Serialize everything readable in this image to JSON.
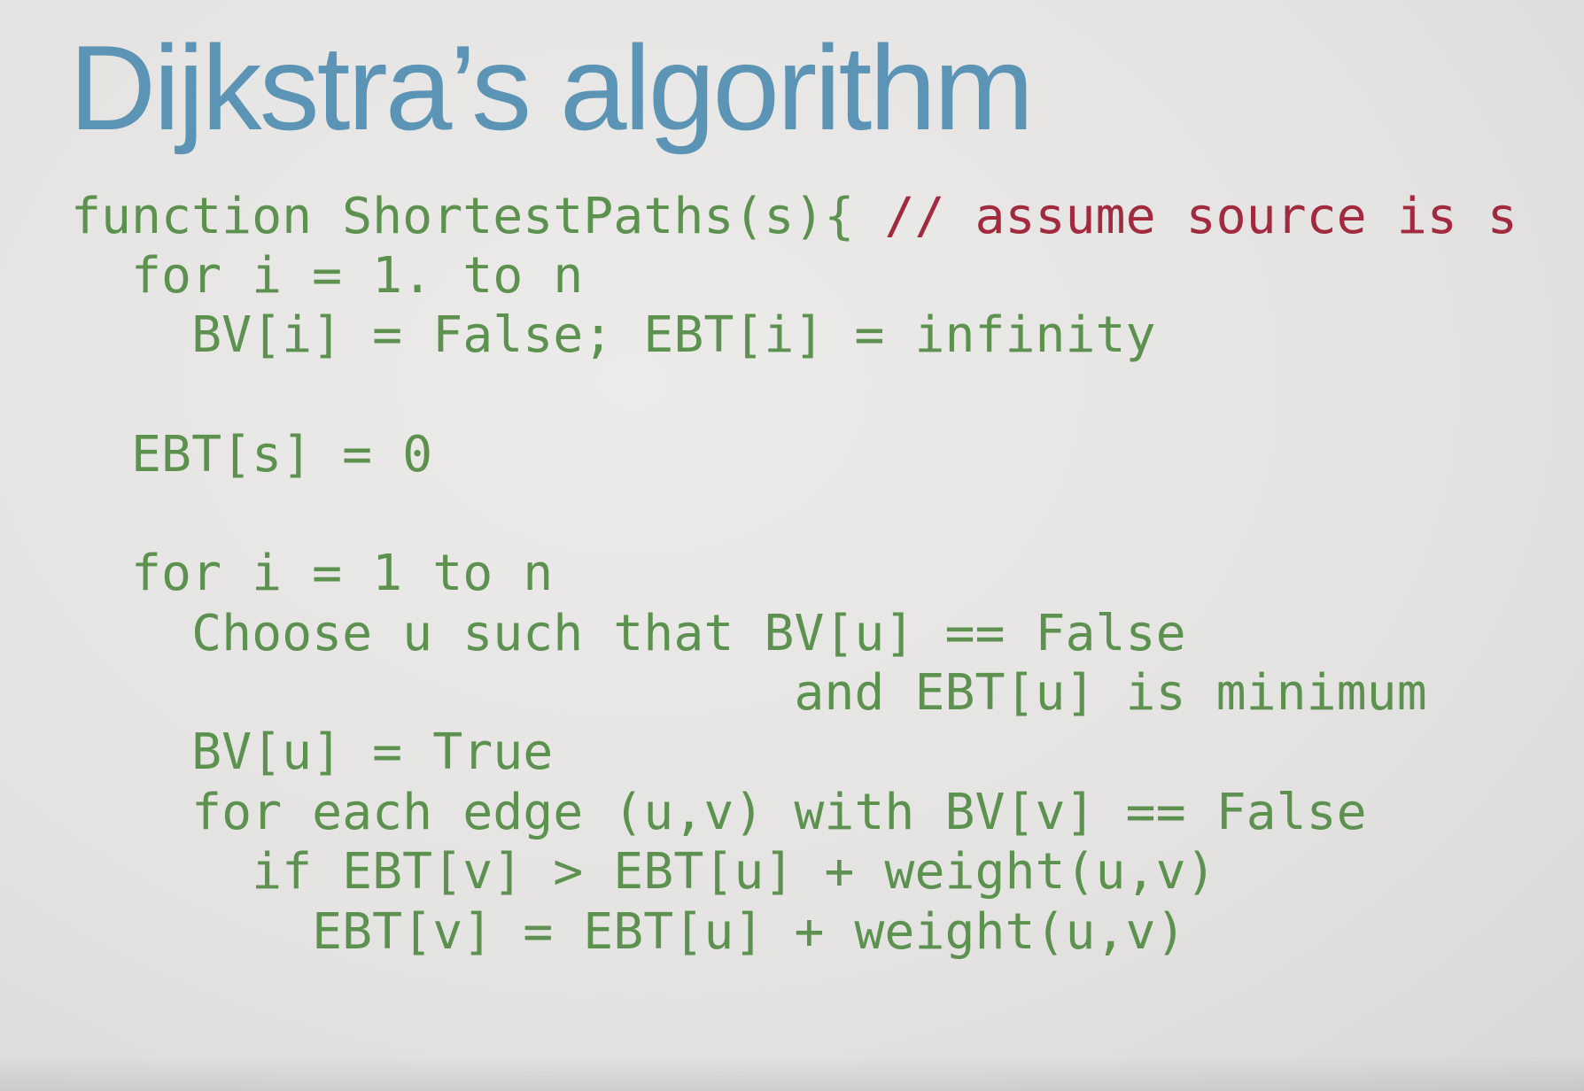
{
  "slide": {
    "title": "Dijkstra’s algorithm",
    "code": [
      {
        "text": "function ShortestPaths(s){",
        "comment": " // assume source is s"
      },
      {
        "text": "  for i = 1. to n"
      },
      {
        "text": "    BV[i] = False; EBT[i] = infinity"
      },
      {
        "text": "  EBT[s] = 0"
      },
      {
        "text": "  for i = 1 to n"
      },
      {
        "text": "    Choose u such that BV[u] == False"
      },
      {
        "text": "                        and EBT[u] is minimum"
      },
      {
        "text": "    BV[u] = True"
      },
      {
        "text": "    for each edge (u,v) with BV[v] == False"
      },
      {
        "text": "      if EBT[v] > EBT[u] + weight(u,v)"
      },
      {
        "text": "        EBT[v] = EBT[u] + weight(u,v)"
      }
    ]
  },
  "colors": {
    "title": "#5b94b4",
    "code": "#5d9150",
    "comment": "#a12a3f",
    "background": "#e6e5e3"
  }
}
